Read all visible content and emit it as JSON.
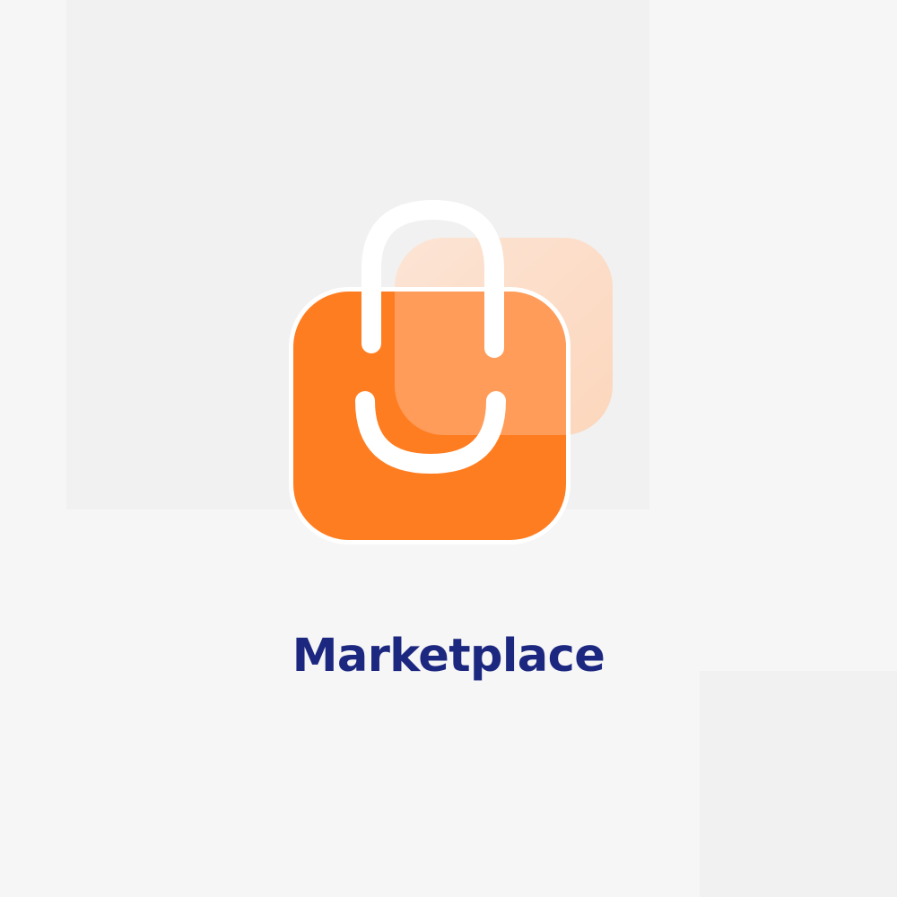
{
  "brand": {
    "name": "Marketplace",
    "icon": "shopping-bag-icon",
    "colors": {
      "primary": "#ff7d21",
      "accent_light": "#fdd6bc",
      "text": "#1c2780",
      "background": "#f6f6f6",
      "panel": "#f1f1f1"
    }
  }
}
